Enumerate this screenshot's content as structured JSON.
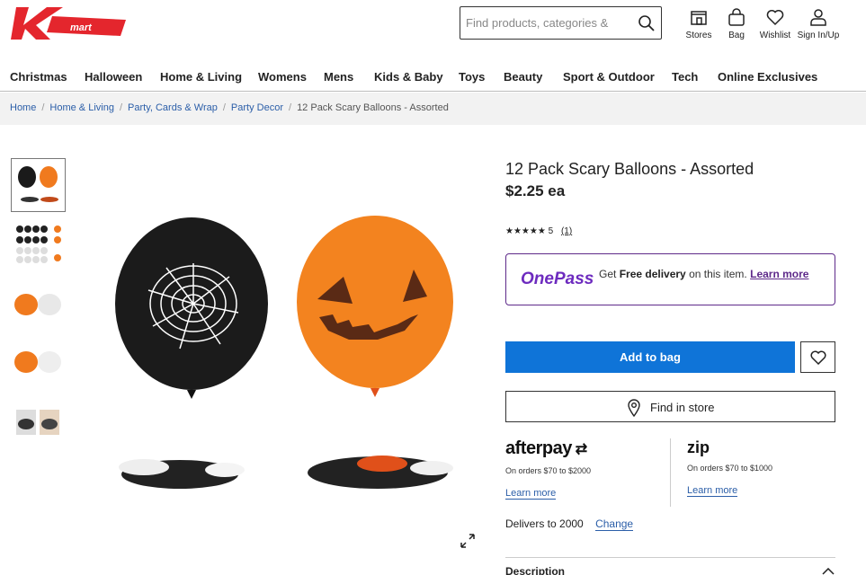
{
  "header": {
    "search_placeholder": "Find products, categories &",
    "icons": [
      {
        "name": "store-icon",
        "label": "Stores"
      },
      {
        "name": "bag-icon",
        "label": "Bag"
      },
      {
        "name": "heart-icon",
        "label": "Wishlist"
      },
      {
        "name": "user-icon",
        "label": "Sign In/Up"
      }
    ],
    "brand_color": "#e4262d"
  },
  "nav": {
    "items": [
      "Christmas",
      "Halloween",
      "Home & Living",
      "Womens",
      "Mens",
      "Kids & Baby",
      "Toys",
      "Beauty",
      "Sport & Outdoor",
      "Tech",
      "Online Exclusives"
    ]
  },
  "breadcrumb": {
    "items": [
      "Home",
      "Home & Living",
      "Party, Cards & Wrap",
      "Party Decor"
    ],
    "current": "12 Pack Scary Balloons - Assorted"
  },
  "product": {
    "title": "12 Pack Scary Balloons - Assorted",
    "price": "$2.25",
    "price_unit": "ea",
    "rating_stars": "★★★★★",
    "rating_value": "5",
    "review_count": "(1)",
    "rating": 5
  },
  "onepass": {
    "logo": "OnePass",
    "text_before": "Get ",
    "text_bold": "Free delivery",
    "text_after": " on this item. ",
    "learn_more": "Learn more"
  },
  "actions": {
    "add_to_bag": "Add to bag",
    "find_in_store": "Find in store"
  },
  "afterpay": {
    "logo": "afterpay",
    "sub": "On orders $70 to $2000",
    "learn_more": "Learn more"
  },
  "zip": {
    "logo": "zip",
    "sub": "On orders $70 to $1000",
    "learn_more": "Learn more"
  },
  "delivery": {
    "text": "Delivers to 2000",
    "change": "Change"
  },
  "description": {
    "label": "Description"
  },
  "colors": {
    "accent_blue": "#0f74d8",
    "onepass_purple": "#6d2bbf",
    "link_blue": "#2b5ea8"
  }
}
